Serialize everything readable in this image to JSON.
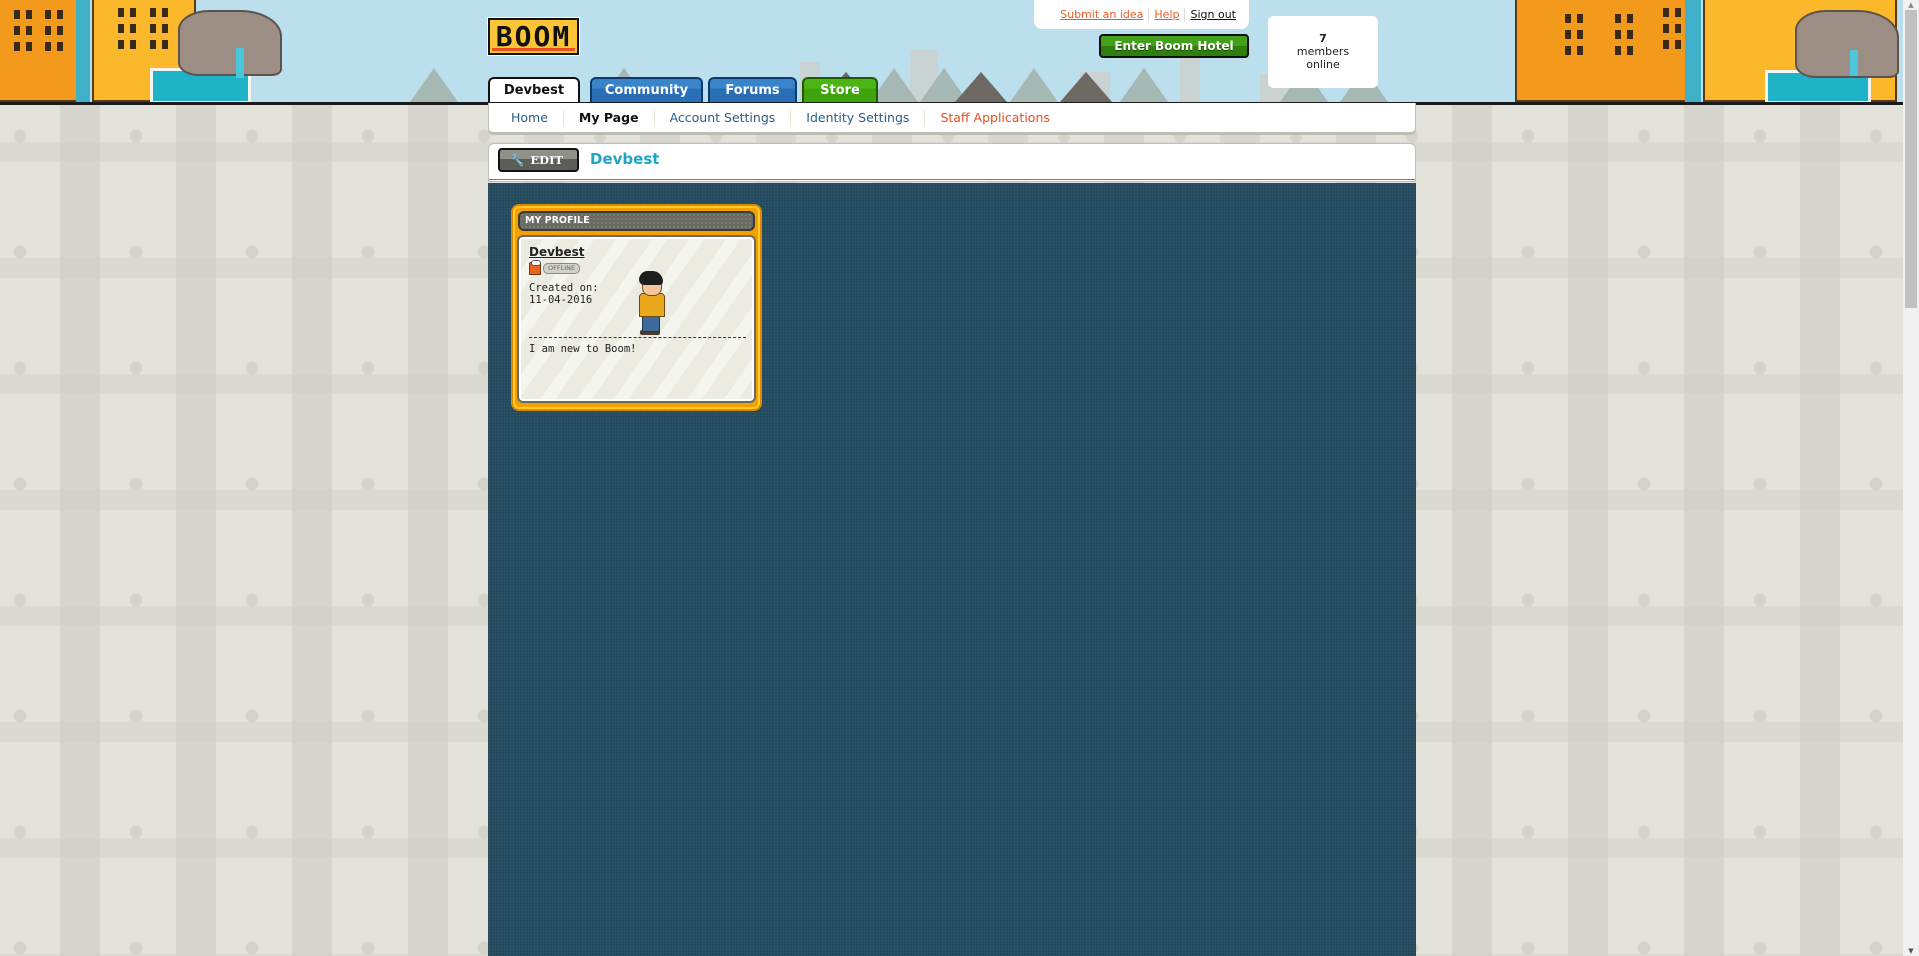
{
  "header": {
    "logo_text": "BOOM",
    "top_links": {
      "submit_idea": "Submit an idea",
      "help": "Help",
      "sign_out": "Sign out"
    },
    "enter_button": "Enter Boom Hotel",
    "online": {
      "count": "7",
      "label_line1": "members",
      "label_line2": "online"
    }
  },
  "tabs": [
    {
      "label": "Devbest",
      "active": true
    },
    {
      "label": "Community",
      "active": false
    },
    {
      "label": "Forums",
      "active": false
    },
    {
      "label": "Store",
      "active": false
    }
  ],
  "subnav": {
    "items": [
      {
        "label": "Home"
      },
      {
        "label": "My Page",
        "current": true
      },
      {
        "label": "Account Settings"
      },
      {
        "label": "Identity Settings"
      },
      {
        "label": "Staff Applications"
      }
    ]
  },
  "editbar": {
    "edit_label": "EDIT",
    "page_title": "Devbest"
  },
  "profile_widget": {
    "title": "MY PROFILE",
    "username": "Devbest",
    "status": "OFFLINE",
    "created_label": "Created on:",
    "created_date": "11-04-2016",
    "motto": "I am new to Boom!"
  },
  "colors": {
    "accent_blue": "#1fa3c6",
    "link_orange": "#ee5a24",
    "content_bg": "#23495e",
    "widget_orange": "#f3a000",
    "enter_green": "#43a01a"
  }
}
